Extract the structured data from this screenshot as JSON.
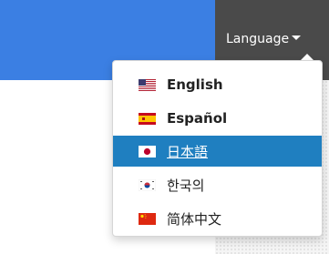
{
  "header": {
    "language_label": "Language"
  },
  "language_menu": {
    "items": [
      {
        "label": "English",
        "flag": "us-flag-icon",
        "selected": false
      },
      {
        "label": "Español",
        "flag": "spain-flag-icon",
        "selected": false
      },
      {
        "label": "日本語",
        "flag": "japan-flag-icon",
        "selected": true
      },
      {
        "label": "한국의",
        "flag": "korea-flag-icon",
        "selected": false
      },
      {
        "label": "简体中文",
        "flag": "china-flag-icon",
        "selected": false
      }
    ]
  },
  "colors": {
    "header_blue": "#3b7fe3",
    "language_button_bg": "#4a4a4a",
    "selected_item_bg": "#1f7fc0"
  }
}
